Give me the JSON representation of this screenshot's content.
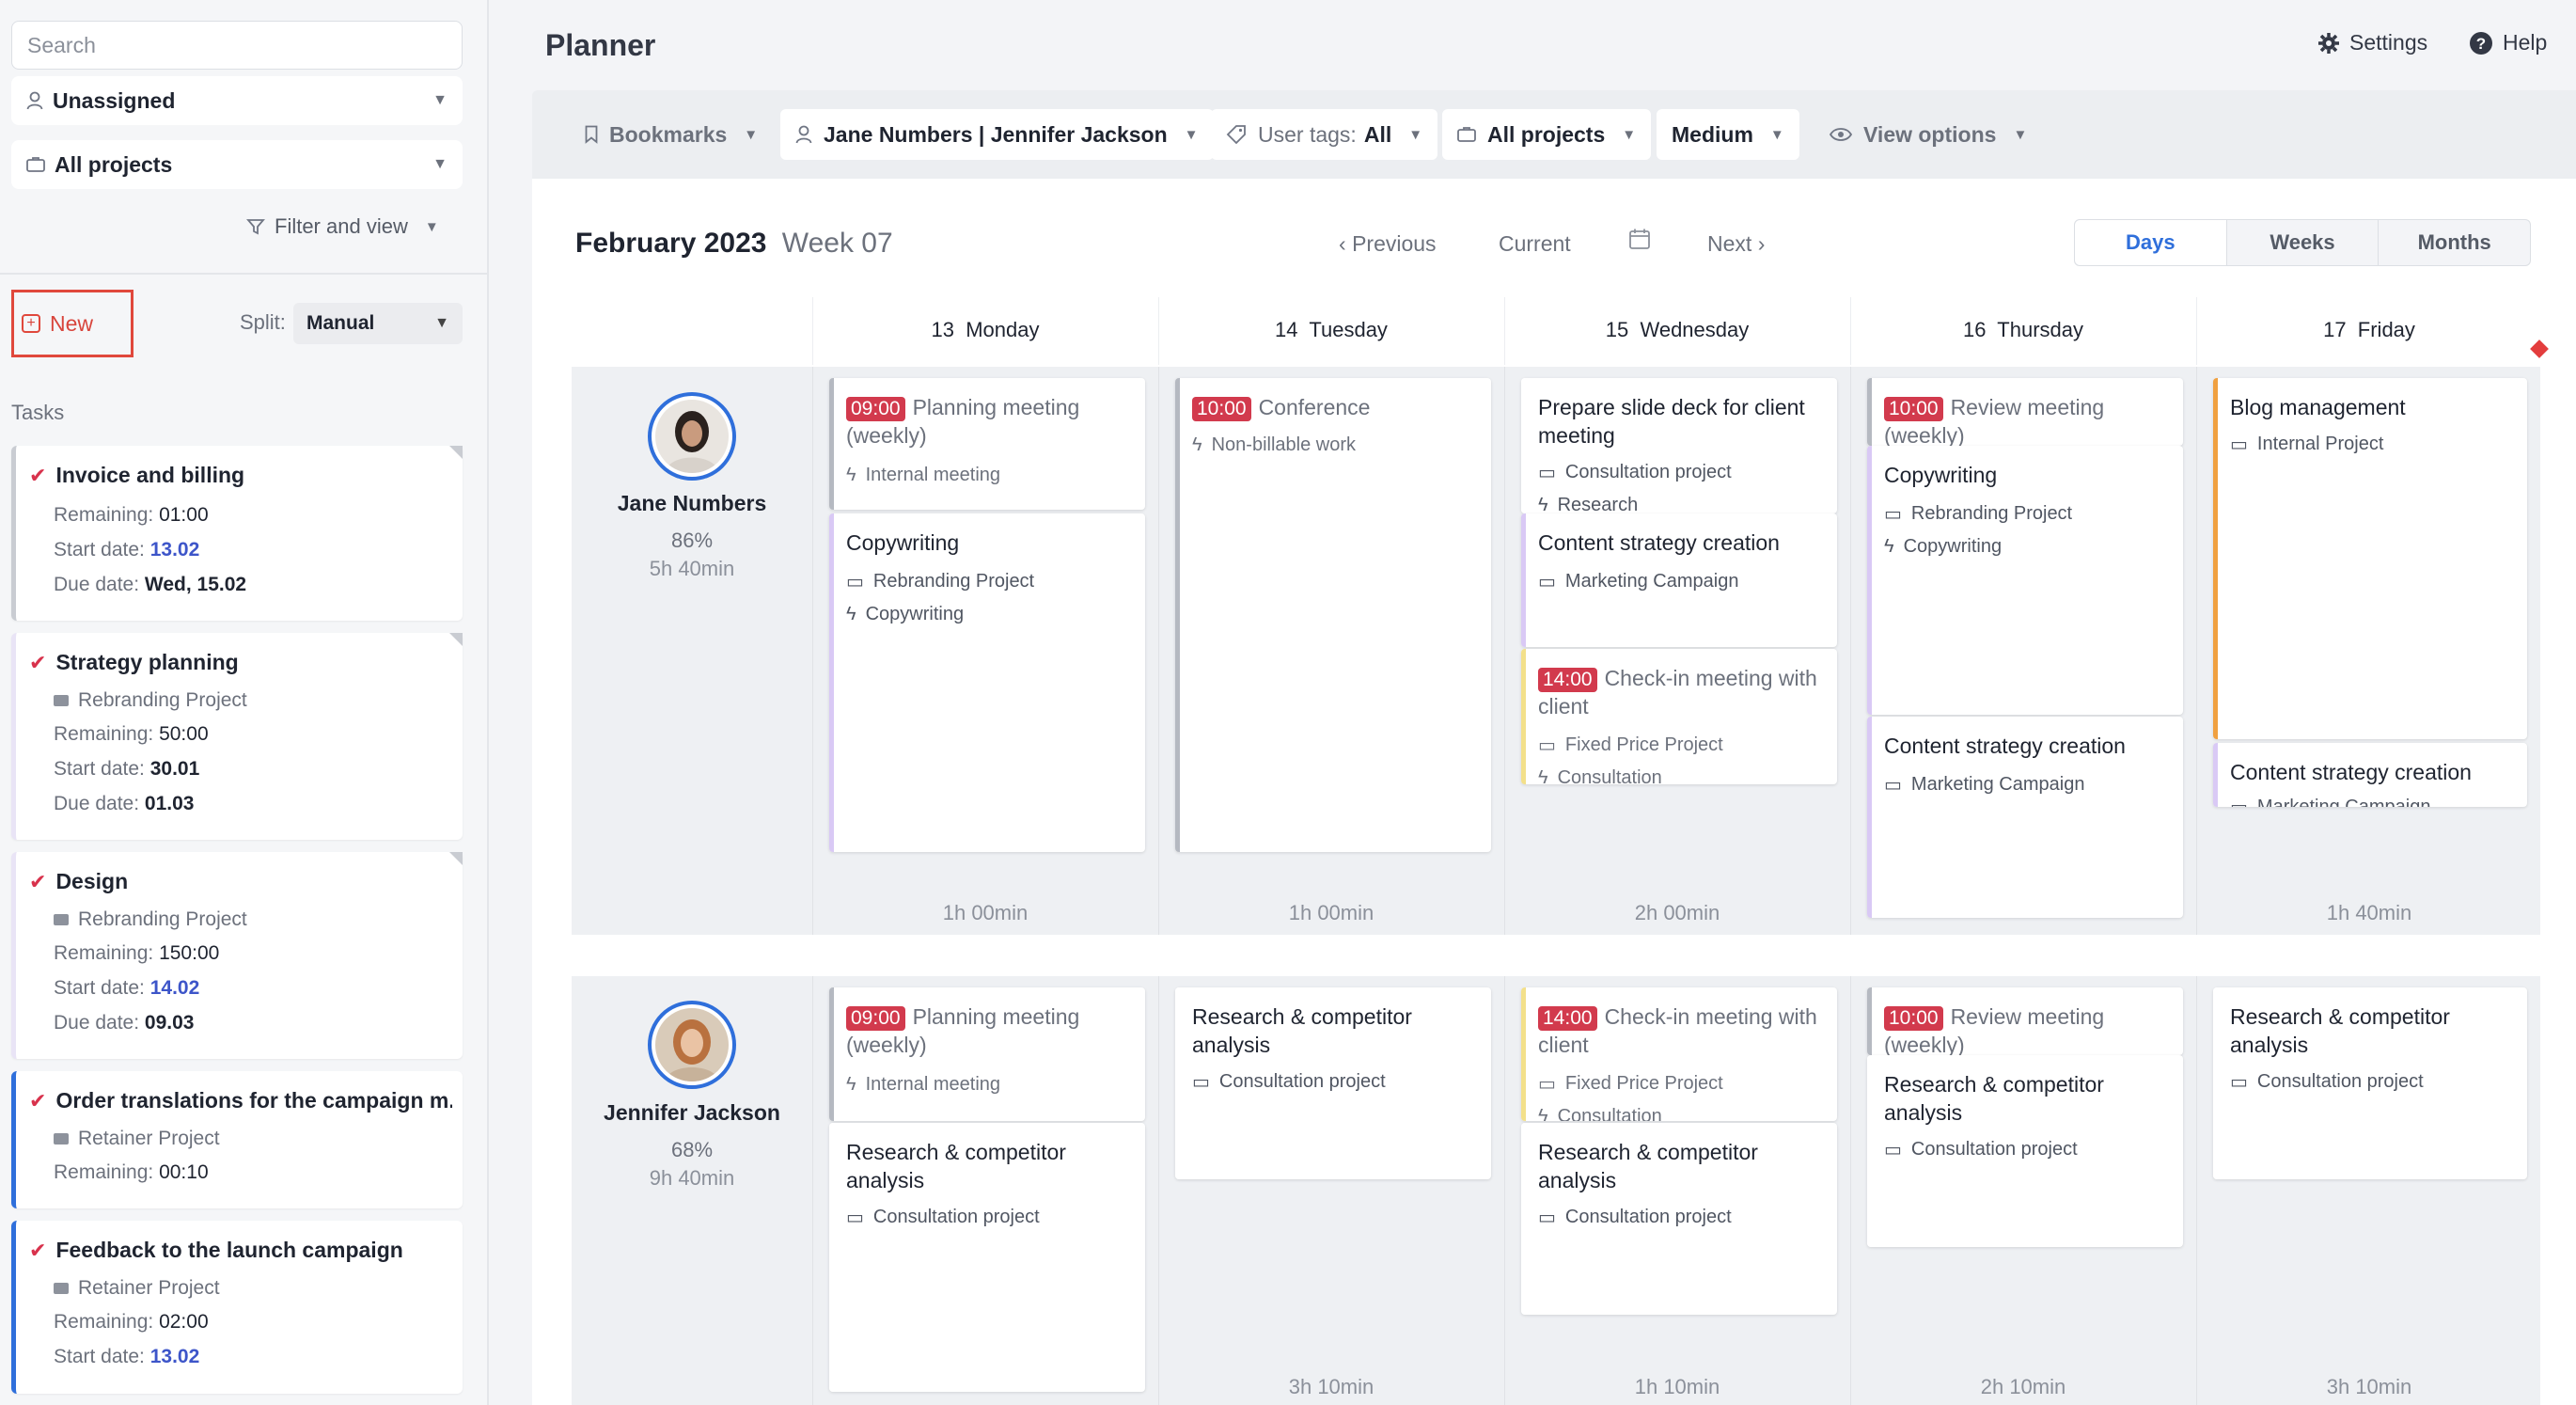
{
  "sidebar": {
    "search_placeholder": "Search",
    "assignee_filter": "Unassigned",
    "projects_filter": "All projects",
    "filter_view_label": "Filter and view",
    "new_label": "New",
    "split_label": "Split:",
    "split_value": "Manual",
    "tasks_heading": "Tasks",
    "tasks": [
      {
        "title": "Invoice and billing",
        "project": "",
        "remaining_label": "Remaining:",
        "remaining": "01:00",
        "start_label": "Start date:",
        "start": "13.02",
        "due_label": "Due date:",
        "due": "Wed, 15.02"
      },
      {
        "title": "Strategy planning",
        "project": "Rebranding Project",
        "remaining_label": "Remaining:",
        "remaining": "50:00",
        "start_label": "Start date:",
        "start": "30.01",
        "due_label": "Due date:",
        "due": "01.03"
      },
      {
        "title": "Design",
        "project": "Rebranding Project",
        "remaining_label": "Remaining:",
        "remaining": "150:00",
        "start_label": "Start date:",
        "start": "14.02",
        "due_label": "Due date:",
        "due": "09.03"
      },
      {
        "title": "Order translations for the campaign m...",
        "project": "Retainer Project",
        "remaining_label": "Remaining:",
        "remaining": "00:10"
      },
      {
        "title": "Feedback to the launch campaign",
        "project": "Retainer Project",
        "remaining_label": "Remaining:",
        "remaining": "02:00",
        "start_label": "Start date:",
        "start": "13.02"
      }
    ]
  },
  "header": {
    "title": "Planner",
    "settings_label": "Settings",
    "help_label": "Help"
  },
  "toolbar": {
    "bookmarks": "Bookmarks",
    "users": "Jane Numbers | Jennifer Jackson",
    "user_tags_label": "User tags:",
    "user_tags_value": "All",
    "projects": "All projects",
    "density": "Medium",
    "view_options": "View options"
  },
  "period": {
    "month": "February 2023",
    "week": "Week 07",
    "previous": "Previous",
    "current": "Current",
    "next": "Next",
    "views": [
      "Days",
      "Weeks",
      "Months"
    ],
    "active_view": "Days"
  },
  "days": [
    {
      "num": "13",
      "name": "Monday"
    },
    {
      "num": "14",
      "name": "Tuesday"
    },
    {
      "num": "15",
      "name": "Wednesday"
    },
    {
      "num": "16",
      "name": "Thursday"
    },
    {
      "num": "17",
      "name": "Friday"
    }
  ],
  "users": [
    {
      "name": "Jane Numbers",
      "utilization": "86%",
      "time": "5h 40min",
      "totals": [
        "1h 00min",
        "1h 00min",
        "2h 00min",
        "",
        "1h 40min"
      ],
      "events": [
        {
          "title": "Planning meeting (weekly)",
          "time": "09:00",
          "sub1": "Internal meeting"
        },
        {
          "title": "Copywriting",
          "sub1": "Rebranding Project",
          "sub2": "Copywriting"
        },
        {
          "title": "Conference",
          "time": "10:00",
          "sub1": "Non-billable work"
        },
        {
          "title": "Prepare slide deck for client meeting",
          "sub1": "Consultation project",
          "sub2": "Research"
        },
        {
          "title": "Content strategy creation",
          "sub1": "Marketing Campaign"
        },
        {
          "title": "Check-in meeting with client",
          "time": "14:00",
          "sub1": "Fixed Price Project",
          "sub2": "Consultation"
        },
        {
          "title": "Review meeting (weekly)",
          "time": "10:00"
        },
        {
          "title": "Copywriting",
          "sub1": "Rebranding Project",
          "sub2": "Copywriting"
        },
        {
          "title": "Content strategy creation",
          "sub1": "Marketing Campaign"
        },
        {
          "title": "Blog management",
          "sub1": "Internal Project"
        },
        {
          "title": "Content strategy creation",
          "sub1": "Marketing Campaign"
        }
      ]
    },
    {
      "name": "Jennifer Jackson",
      "utilization": "68%",
      "time": "9h 40min",
      "totals": [
        "",
        "3h 10min",
        "1h 10min",
        "2h 10min",
        "3h 10min"
      ],
      "events": [
        {
          "title": "Planning meeting (weekly)",
          "time": "09:00",
          "sub1": "Internal meeting"
        },
        {
          "title": "Research & competitor analysis",
          "sub1": "Consultation project"
        },
        {
          "title": "Research & competitor analysis",
          "sub1": "Consultation project"
        },
        {
          "title": "Check-in meeting with client",
          "time": "14:00",
          "sub1": "Fixed Price Project",
          "sub2": "Consultation"
        },
        {
          "title": "Research & competitor analysis",
          "sub1": "Consultation project"
        },
        {
          "title": "Review meeting (weekly)",
          "time": "10:00"
        },
        {
          "title": "Research & competitor analysis",
          "sub1": "Consultation project"
        },
        {
          "title": "Research & competitor analysis",
          "sub1": "Consultation project"
        }
      ]
    }
  ],
  "colors": {
    "accent_blue": "#2f6fdb",
    "badge_red": "#d23a4d",
    "new_outline": "#e0483c",
    "bar_gray": "#b5b9c1",
    "bar_purple": "#d9c9f5",
    "bar_yellow": "#f3e08a",
    "bar_orange": "#f0a040"
  }
}
